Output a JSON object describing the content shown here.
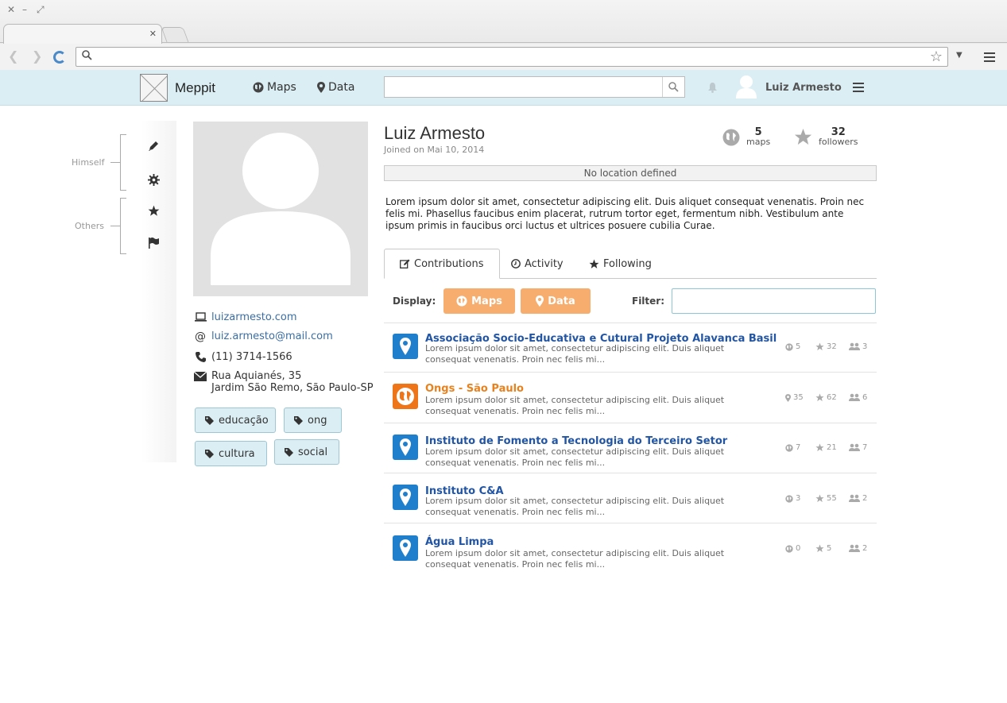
{
  "app": {
    "brand": "Meppit",
    "nav": {
      "maps": "Maps",
      "data": "Data"
    },
    "user_name": "Luiz Armesto"
  },
  "sidenav": {
    "group1": "Himself",
    "group2": "Others",
    "icons": [
      "pencil-icon",
      "gear-icon",
      "star-icon",
      "flag-icon"
    ]
  },
  "profile": {
    "name": "Luiz Armesto",
    "joined": "Joined on Mai 10, 2014",
    "maps_count": "5",
    "maps_label": "maps",
    "followers_count": "32",
    "followers_label": "followers",
    "location": "No location defined",
    "bio": "Lorem ipsum dolor sit amet, consectetur adipiscing elit. Duis aliquet consequat venenatis. Proin nec felis mi. Phasellus faucibus enim placerat, rutrum tortor eget, fermentum nibh. Vestibulum ante ipsum primis in faucibus orci luctus et ultrices posuere cubilia Curae.",
    "website": "luizarmesto.com",
    "email": "luiz.armesto@mail.com",
    "phone": "(11) 3714-1566",
    "address_line1": "Rua Aquianés, 35",
    "address_line2": "Jardim São Remo, São Paulo-SP",
    "tags": [
      "educação",
      "ong",
      "cultura",
      "social"
    ]
  },
  "tabs": {
    "contributions": "Contributions",
    "activity": "Activity",
    "following": "Following"
  },
  "toolbar": {
    "display_label": "Display:",
    "maps_btn": "Maps",
    "data_btn": "Data",
    "filter_label": "Filter:",
    "filter_value": ""
  },
  "colors": {
    "accent_orange": "#f7ad6e",
    "map_blue": "#1f7fcc",
    "data_orange": "#ee7518",
    "title_blue": "#2255a4",
    "title_orange": "#e8821f"
  },
  "contributions": [
    {
      "title": "Associação Socio-Educativa e Cutural Projeto Alavanca Basil",
      "desc1": "Lorem ipsum dolor sit amet, consectetur adipiscing elit. Duis aliquet",
      "desc2": "consequat venenatis. Proin nec felis mi...",
      "kind": "map",
      "m1": "5",
      "m1_icon": "globe-icon",
      "m2": "32",
      "m3": "3"
    },
    {
      "title": "Ongs - São Paulo",
      "desc1": "Lorem ipsum dolor sit amet, consectetur adipiscing elit. Duis aliquet",
      "desc2": "consequat venenatis. Proin nec felis mi...",
      "kind": "data",
      "m1": "35",
      "m1_icon": "marker-icon",
      "m2": "62",
      "m3": "6"
    },
    {
      "title": "Instituto de Fomento a Tecnologia do Terceiro Setor",
      "desc1": "Lorem ipsum dolor sit amet, consectetur adipiscing elit. Duis aliquet",
      "desc2": "consequat venenatis. Proin nec felis mi...",
      "kind": "map",
      "m1": "7",
      "m1_icon": "globe-icon",
      "m2": "21",
      "m3": "7"
    },
    {
      "title": "Instituto C&A",
      "desc1": "Lorem ipsum dolor sit amet, consectetur adipiscing elit. Duis aliquet",
      "desc2": "consequat venenatis. Proin nec felis mi...",
      "kind": "map",
      "m1": "3",
      "m1_icon": "globe-icon",
      "m2": "55",
      "m3": "2"
    },
    {
      "title": "Água Limpa",
      "desc1": "Lorem ipsum dolor sit amet, consectetur adipiscing elit. Duis aliquet",
      "desc2": "consequat venenatis. Proin nec felis mi...",
      "kind": "map",
      "m1": "0",
      "m1_icon": "globe-icon",
      "m2": "5",
      "m3": "2"
    }
  ]
}
